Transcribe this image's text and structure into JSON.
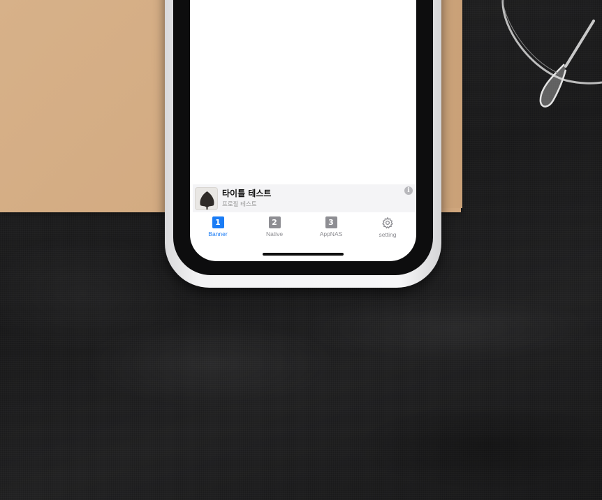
{
  "ad_banner": {
    "title": "타이틀 테스트",
    "subtitle": "프로필 테스트",
    "info_glyph": "i"
  },
  "tab_bar": {
    "active_color": "#1a7cf5",
    "inactive_color": "#8e8e93",
    "tabs": [
      {
        "label": "Banner",
        "icon_text": "1",
        "icon": "number-1-icon",
        "active": true
      },
      {
        "label": "Native",
        "icon_text": "2",
        "icon": "number-2-icon",
        "active": false
      },
      {
        "label": "AppNAS",
        "icon_text": "3",
        "icon": "number-3-icon",
        "active": false
      },
      {
        "label": "setting",
        "icon_text": "",
        "icon": "gear-icon",
        "active": false
      }
    ]
  }
}
